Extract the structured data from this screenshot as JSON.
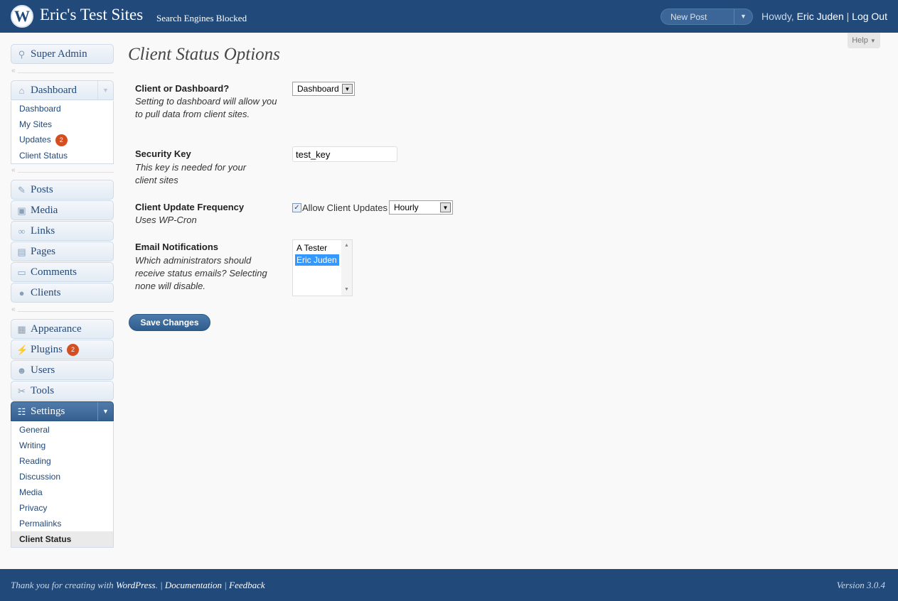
{
  "header": {
    "site_title": "Eric's Test Sites",
    "site_status": "Search Engines Blocked",
    "new_post_label": "New Post",
    "howdy": "Howdy, ",
    "user_name": "Eric Juden",
    "separator": "|",
    "logout": "Log Out"
  },
  "help": {
    "label": "Help",
    "arrow": "▼"
  },
  "sidebar": {
    "super_admin": "Super Admin",
    "dashboard": "Dashboard",
    "dashboard_sub": [
      "Dashboard",
      "My Sites",
      "Updates",
      "Client Status"
    ],
    "updates_count": "2",
    "posts": "Posts",
    "media": "Media",
    "links": "Links",
    "pages": "Pages",
    "comments": "Comments",
    "clients": "Clients",
    "appearance": "Appearance",
    "plugins": "Plugins",
    "plugins_count": "2",
    "users": "Users",
    "tools": "Tools",
    "settings": "Settings",
    "settings_sub": [
      "General",
      "Writing",
      "Reading",
      "Discussion",
      "Media",
      "Privacy",
      "Permalinks",
      "Client Status"
    ]
  },
  "main": {
    "title": "Client Status Options",
    "fields": {
      "client_or_dashboard": {
        "title": "Client or Dashboard?",
        "desc": "Setting to dashboard will allow you to pull data from client sites.",
        "value": "Dashboard"
      },
      "security_key": {
        "title": "Security Key",
        "desc": "This key is needed for your client sites",
        "value": "test_key"
      },
      "update_frequency": {
        "title": "Client Update Frequency",
        "desc": "Uses WP-Cron",
        "checkbox_label": "Allow Client Updates",
        "checked": true,
        "value": "Hourly"
      },
      "email_notifications": {
        "title": "Email Notifications",
        "desc": "Which administrators should receive status emails? Selecting none will disable.",
        "options": [
          "A Tester",
          "Eric Juden"
        ],
        "selected": "Eric Juden"
      }
    },
    "save_label": "Save Changes"
  },
  "footer": {
    "thanks": "Thank you for creating with ",
    "wordpress": "WordPress",
    "documentation": "Documentation",
    "feedback": "Feedback",
    "version": "Version 3.0.4"
  },
  "colors": {
    "header_bg": "#21497a",
    "accent": "#21497a",
    "badge": "#d54e21",
    "selected_option": "#3399ff"
  }
}
